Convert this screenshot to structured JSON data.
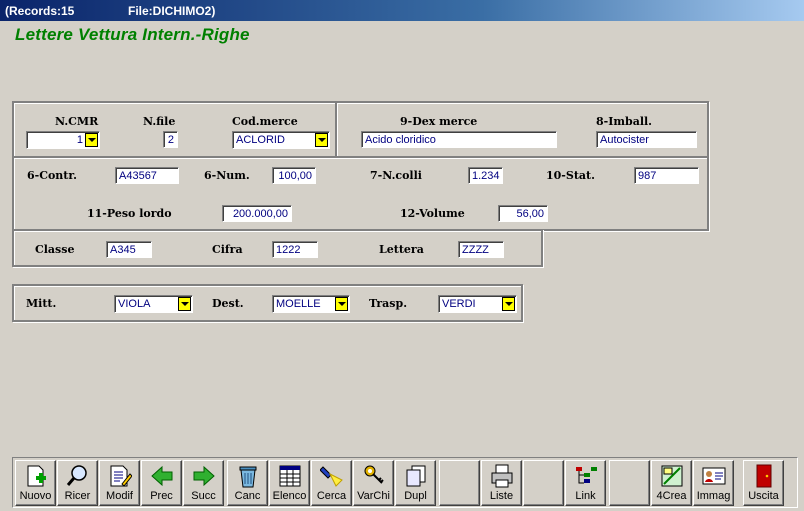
{
  "titlebar": {
    "records": "(Records:15",
    "file": "File:DICHIMO2)"
  },
  "form_title": "Lettere Vettura Intern.-Righe",
  "section1": {
    "ncmr_label": "N.CMR",
    "ncmr_value": "1",
    "nfile_label": "N.file",
    "nfile_value": "2",
    "codmerce_label": "Cod.merce",
    "codmerce_value": "ACLORID"
  },
  "section2": {
    "dexmerce_label": "9-Dex merce",
    "dexmerce_value": "Acido cloridico",
    "imball_label": "8-Imball.",
    "imball_value": "Autocister"
  },
  "section3": {
    "contr_label": "6-Contr.",
    "contr_value": "A43567",
    "num_label": "6-Num.",
    "num_value": "100,00",
    "ncolli_label": "7-N.colli",
    "ncolli_value": "1.234",
    "stat_label": "10-Stat.",
    "stat_value": "987",
    "peso_label": "11-Peso lordo",
    "peso_value": "200.000,00",
    "volume_label": "12-Volume",
    "volume_value": "56,00"
  },
  "section4": {
    "classe_label": "Classe",
    "classe_value": "A345",
    "cifra_label": "Cifra",
    "cifra_value": "1222",
    "lettera_label": "Lettera",
    "lettera_value": "ZZZZ"
  },
  "section5": {
    "mitt_label": "Mitt.",
    "mitt_value": "VIOLA",
    "dest_label": "Dest.",
    "dest_value": "MOELLE",
    "trasp_label": "Trasp.",
    "trasp_value": "VERDI"
  },
  "toolbar": {
    "nuovo": "Nuovo",
    "ricer": "Ricer",
    "modif": "Modif",
    "prec": "Prec",
    "succ": "Succ",
    "canc": "Canc",
    "elenco": "Elenco",
    "cerca": "Cerca",
    "varchi": "VarChi",
    "dupl": "Dupl",
    "liste": "Liste",
    "link": "Link",
    "crea": "4Crea",
    "immag": "Immag",
    "uscita": "Uscita"
  },
  "colors": {
    "field_text": "#000080",
    "title_green": "#008000",
    "combo_button": "#ffff00"
  }
}
